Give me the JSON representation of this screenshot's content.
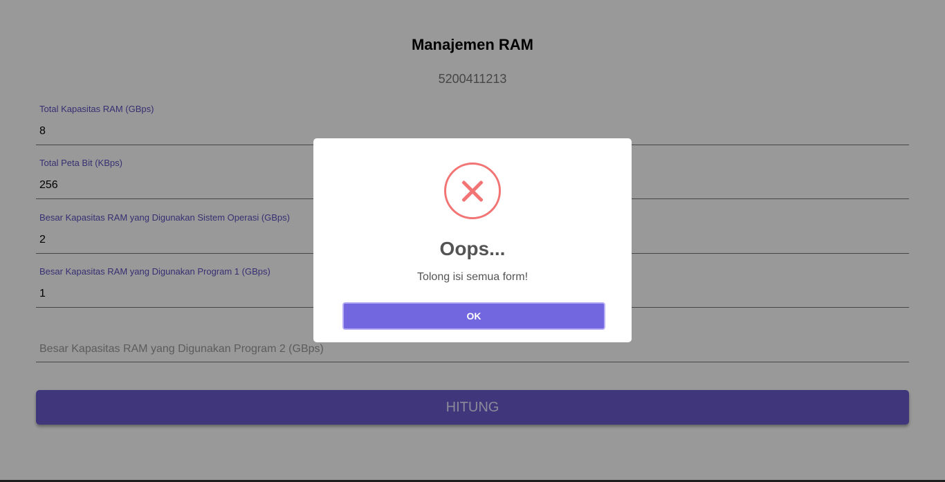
{
  "header": {
    "title": "Manajemen RAM",
    "subtitle": "5200411213"
  },
  "form": {
    "fields": [
      {
        "label": "Total Kapasitas RAM (GBps)",
        "value": "8"
      },
      {
        "label": "Total Peta Bit (KBps)",
        "value": "256"
      },
      {
        "label": "Besar Kapasitas RAM yang Digunakan Sistem Operasi (GBps)",
        "value": "2"
      },
      {
        "label": "Besar Kapasitas RAM yang Digunakan Program 1 (GBps)",
        "value": "1"
      }
    ],
    "program2_placeholder": "Besar Kapasitas RAM yang Digunakan Program 2 (GBps)",
    "submit_label": "HITUNG"
  },
  "dialog": {
    "icon": "error-x-icon",
    "title": "Oops...",
    "message": "Tolong isi semua form!",
    "ok_label": "OK"
  },
  "colors": {
    "accent": "#6a5acd",
    "error": "#f27474",
    "ok_button": "#7367e0"
  }
}
